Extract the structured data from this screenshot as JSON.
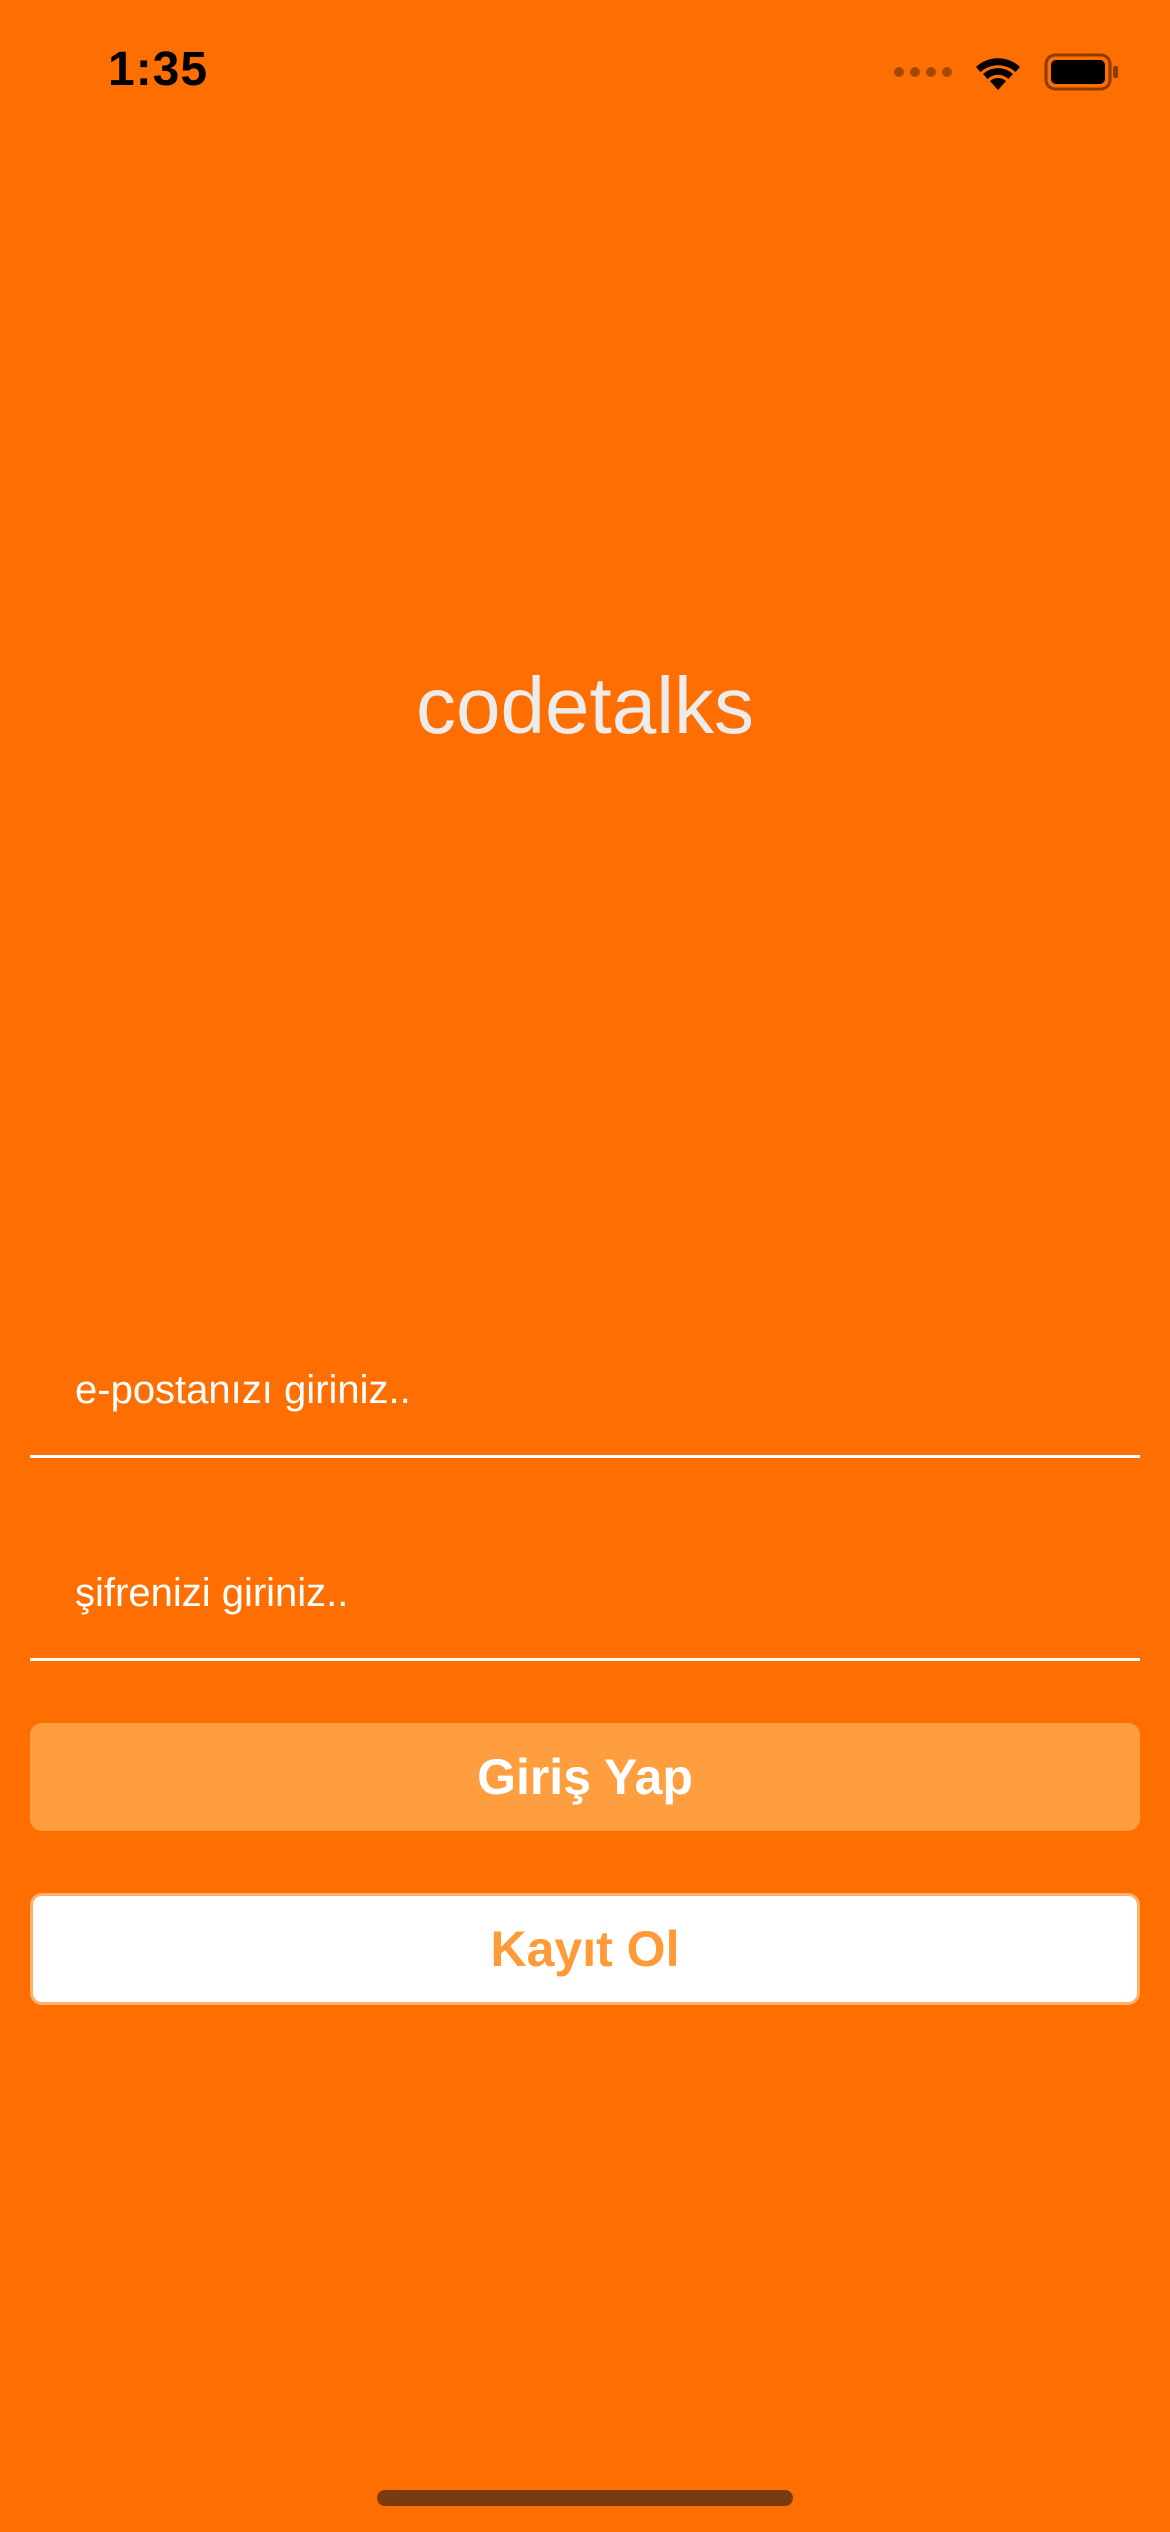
{
  "status_bar": {
    "time": "1:35",
    "icons": [
      "signal-icon",
      "wifi-icon",
      "battery-icon"
    ]
  },
  "app": {
    "title": "codetalks"
  },
  "form": {
    "email_placeholder": "e-postanızı giriniz..",
    "email_value": "",
    "password_placeholder": "şifrenizi giriniz..",
    "password_value": "",
    "login_label": "Giriş Yap",
    "register_label": "Kayıt Ol"
  },
  "colors": {
    "background": "#FF6E00",
    "login_button": "#FF9E3F",
    "register_text": "#FF9A38",
    "title_text": "#ECECEC"
  }
}
